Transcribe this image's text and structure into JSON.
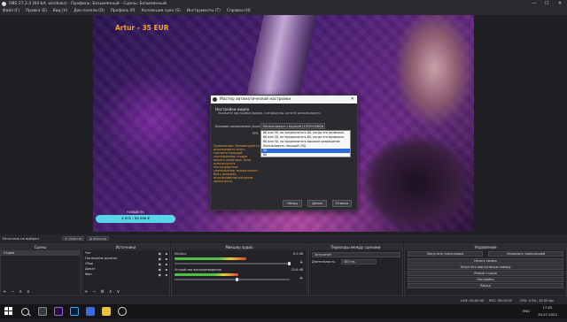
{
  "window": {
    "title": "OBS 27.2.4 (64-bit, windows) - Профиль: Безымянный - Сцены: Безымянный",
    "controls": [
      "—",
      "☐",
      "✕"
    ]
  },
  "menu": [
    "Файл (F)",
    "Правка (E)",
    "Вид (V)",
    "Док-панели (D)",
    "Профиль (P)",
    "Коллекция сцен (S)",
    "Инструменты (T)",
    "Справка (H)"
  ],
  "canvas": {
    "donation_text": "Artur - 35 EUR",
    "goal_title": "НОВЫЙ ПК",
    "goal_progress": "3 571 / 50 000 ₽"
  },
  "dialog": {
    "title": "Мастер автоматической настройки",
    "heading": "Настройки видео",
    "subheading": "Укажите настройки видео, которые вы хотите использовать",
    "base_resolution_label": "Базовое разрешение (холст)",
    "base_resolution_value": "Использовать текущий (1920x1080)",
    "fps_label": "FPS",
    "fps_options": [
      "60 или 30, но предпочитать 60, когда это возможно",
      "60 или 30, но предпочитать 60, когда это возможно",
      "60 или 30, но предпочитать высокое разрешение",
      "Использовать текущий (30)",
      "30",
      "60"
    ],
    "fps_selected_index": 4,
    "warning": "Примечание: Рекомендуется использовать холст, соответствующий соотношению сторон вашего монитора. Если используется нестандартное соотношение, выход может быть искажён, использование ресурсов увеличится.",
    "buttons": {
      "back": "Назад",
      "next": "Далее",
      "cancel": "Отмена"
    }
  },
  "sources_bar": {
    "no_source": "Источник не выбран",
    "properties": "Свойства",
    "filters": "Фильтры"
  },
  "scenes": {
    "header": "Сцены",
    "items": [
      "Стрим"
    ]
  },
  "sources": {
    "header": "Источники",
    "items": [
      "Чат",
      "Последние донаты",
      "Сбор",
      "Донат",
      "Фон"
    ]
  },
  "mixer": {
    "header": "Микшер аудио",
    "channels": [
      {
        "name": "Mic/Aux",
        "db": "0.0 dB",
        "level": 0.62
      },
      {
        "name": "Устройство воспроизведения",
        "db": "-15.6 dB",
        "level": 0.55
      }
    ]
  },
  "transitions": {
    "header": "Переходы между сценами",
    "type_label": "",
    "type_value": "Затухание",
    "duration_label": "Длительность",
    "duration_value": "300 ms"
  },
  "controls": {
    "header": "Управление",
    "buttons": [
      [
        "Запустить трансляцию",
        "Управлять трансляцией"
      ],
      [
        "Начать запись"
      ],
      [
        "Запустить виртуальную камеру"
      ],
      [
        "Режим студии"
      ],
      [
        "Настройки"
      ],
      [
        "Выход"
      ]
    ]
  },
  "status": {
    "live": "LIVE: 00:00:00",
    "rec": "REC: 00:00:00",
    "cpu": "CPU: 0.3%, 30.00 fps"
  },
  "taskbar": {
    "time": "17:02",
    "date": "30.07.2022",
    "lang": "ENG"
  }
}
